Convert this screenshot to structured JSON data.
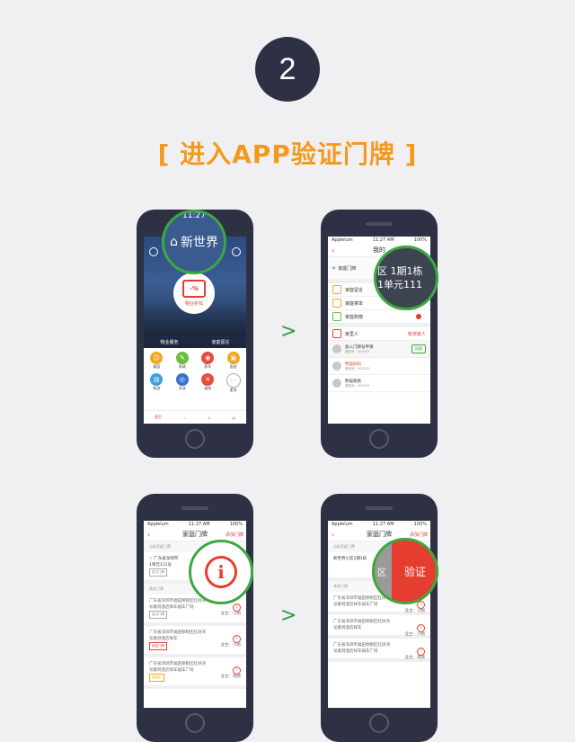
{
  "step": {
    "number": "2"
  },
  "title": "[ 进入APP验证门牌 ]",
  "arrows": [
    ">",
    ">"
  ],
  "phone1": {
    "time": "11:27",
    "community": "新世界",
    "center_label": "物业折扣",
    "center_sign": "-%",
    "strip": [
      "物业服务",
      "家庭留言"
    ],
    "grid": [
      {
        "label": "美容",
        "color": "#f2a623",
        "icon": "☺"
      },
      {
        "label": "家政",
        "color": "#6abf3f",
        "icon": "✎"
      },
      {
        "label": "养车",
        "color": "#e94c3d",
        "icon": "◉"
      },
      {
        "label": "配送",
        "color": "#f2a623",
        "icon": "▣"
      },
      {
        "label": "物流",
        "color": "#3fa0e0",
        "icon": "▤"
      },
      {
        "label": "洗涤",
        "color": "#3a6fd0",
        "icon": "◎"
      },
      {
        "label": "维修",
        "color": "#e94c3d",
        "icon": "✕"
      },
      {
        "label": "更多",
        "color": "#ffffff",
        "icon": "⋯"
      }
    ],
    "tabs": [
      "首页",
      "",
      "",
      ""
    ]
  },
  "phone2": {
    "status": {
      "carrier": "Applelum",
      "time": "11:27 AM",
      "battery": "100%"
    },
    "nav_title": "我的",
    "house_label": "家庭门牌",
    "house_address_line1": "区 1期1栋",
    "house_address_line2": "1单元111",
    "menu": [
      {
        "label": "家庭留言",
        "color": "#f2a623",
        "badge": false
      },
      {
        "label": "家庭菜单",
        "color": "#f2a623",
        "badge": true
      },
      {
        "label": "家庭购物",
        "color": "#6abf3f",
        "badge": true
      }
    ],
    "members_label": "家里人",
    "add_member": "新增家人",
    "members": [
      {
        "name": "加入门牌号申请",
        "sub": "赛验号：400003",
        "action": "同意",
        "highlight": false
      },
      {
        "name": "熊猫妈妈",
        "sub": "赛验号：400023",
        "action": "",
        "highlight": true
      },
      {
        "name": "熊猫爸爸",
        "sub": "赛验号：400023",
        "action": "",
        "highlight": false
      }
    ]
  },
  "phone3": {
    "status": {
      "carrier": "Applelum",
      "time": "11:27 AM",
      "battery": "100%"
    },
    "nav_title": "家庭门牌",
    "nav_right": "添加门牌",
    "current_label": "当前家庭门牌",
    "current_address": "广东省深圳市",
    "current_unit": "1单元111号",
    "current_tag": "显示门牌",
    "other_label": "其他门牌",
    "cards": [
      {
        "line1": "广东省深圳市福田保税区红树湾",
        "line2": "号素则酒店样车福车广场",
        "owner": "业主：小刚",
        "tag": "显示门牌",
        "tag_red": false
      },
      {
        "line1": "广东省深圳市福田保税区红树湾",
        "line2": "号素则酒店样车",
        "owner": "业主：小刚",
        "tag": "验证门牌",
        "tag_red": true
      },
      {
        "line1": "广东省深圳市福田保税区红树湾",
        "line2": "号素则酒店样车福车广场",
        "owner": "业主：周颜",
        "tag": "验证中",
        "tag_red": false
      }
    ]
  },
  "phone4": {
    "status": {
      "carrier": "Applelum",
      "time": "11:27 AM",
      "battery": "100%"
    },
    "nav_title": "家庭门牌",
    "nav_right": "添加门牌",
    "current_label": "当前家庭门牌",
    "current_address": "新世界小区1期1栋",
    "current_owner": "业主：小明",
    "other_label": "其他门牌",
    "swipe_grey": "区",
    "swipe_red": "验证",
    "cards": [
      {
        "line1": "广东省深圳市福田保税区红树湾",
        "line2": "号素则酒店样车福车广场",
        "owner": "业主：小刚"
      },
      {
        "line1": "广东省深圳市福田保税区红树湾",
        "line2": "号素则酒店样车",
        "owner": "业主：小刚"
      },
      {
        "line1": "广东省深圳市福田保税区红树湾",
        "line2": "号素则酒店样车福车广场",
        "owner": "业主：周颜"
      }
    ]
  }
}
